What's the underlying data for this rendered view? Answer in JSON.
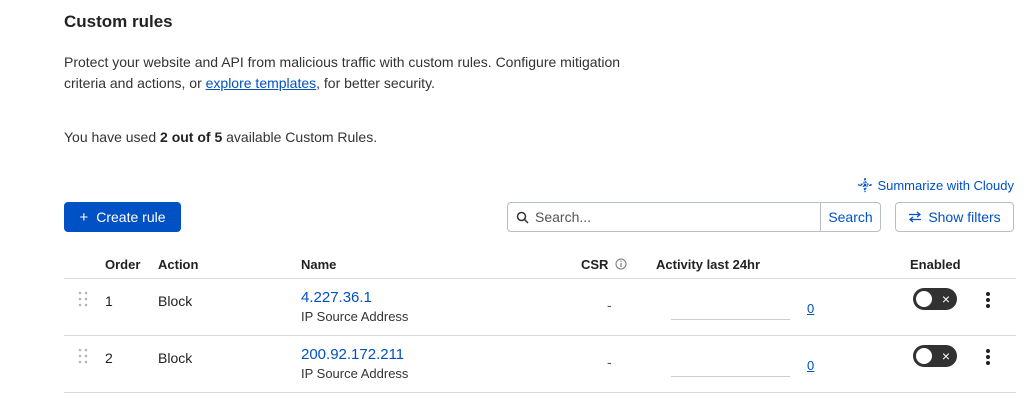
{
  "header": {
    "title": "Custom rules",
    "desc_before": "Protect your website and API from malicious traffic with custom rules. Configure mitigation criteria and actions, or ",
    "desc_link": "explore templates",
    "desc_after": ", for better security.",
    "usage_prefix": "You have used ",
    "usage_count": "2 out of 5",
    "usage_suffix": " available Custom Rules."
  },
  "toolbar": {
    "cloudy_label": "Summarize with Cloudy",
    "create_label": "Create rule",
    "search_placeholder": "Search...",
    "search_button": "Search",
    "filters_label": "Show filters"
  },
  "table": {
    "columns": {
      "order": "Order",
      "action": "Action",
      "name": "Name",
      "csr": "CSR",
      "activity": "Activity last 24hr",
      "enabled": "Enabled"
    },
    "rows": [
      {
        "order": "1",
        "action": "Block",
        "name": "4.227.36.1",
        "subtitle": "IP Source Address",
        "csr": "-",
        "activity_count": "0",
        "enabled": false
      },
      {
        "order": "2",
        "action": "Block",
        "name": "200.92.172.211",
        "subtitle": "IP Source Address",
        "csr": "-",
        "activity_count": "0",
        "enabled": false
      }
    ]
  },
  "colors": {
    "accent": "#0051c3",
    "toggle_off": "#313131"
  }
}
